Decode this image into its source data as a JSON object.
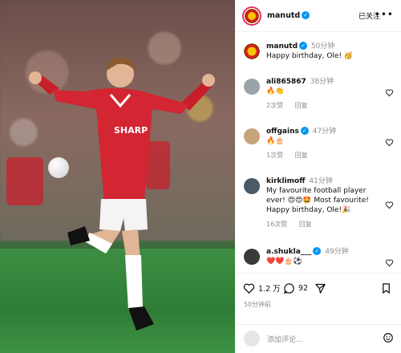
{
  "post": {
    "username": "manutd",
    "follow_label": "已关注",
    "more_label": "•••",
    "caption_user": "manutd",
    "caption_time": "50分钟",
    "caption_text": "Happy birthday, Ole! 🥳",
    "shirt_text": "SHARP"
  },
  "comments": [
    {
      "user": "ali865867",
      "verified": false,
      "time": "38分钟",
      "text": "🔥👏",
      "likes": "2次赞",
      "reply": "回复"
    },
    {
      "user": "offgains",
      "verified": true,
      "time": "47分钟",
      "text": "🔥🎂",
      "likes": "1次赞",
      "reply": "回复"
    },
    {
      "user": "kirklimoff",
      "verified": false,
      "time": "41分钟",
      "text": "My favourite football player ever! 😍😍🤩 Most favourite! Happy birthday, Ole!🎉",
      "likes": "16次赞",
      "reply": "回复"
    },
    {
      "user": "a.shukla___",
      "verified": true,
      "time": "49分钟",
      "text": "❤️❤️🎂⚽",
      "likes": "",
      "reply": ""
    }
  ],
  "actions": {
    "likes": "1.2 万",
    "comments": "92",
    "time_ago": "50分钟前"
  },
  "add_comment": {
    "placeholder": "添加评论..."
  },
  "colors": {
    "verified": "#0095f6",
    "story_ring": "#e1306c",
    "united_red": "#d81f26"
  },
  "icons": [
    "more-icon",
    "verified-icon",
    "heart-icon",
    "comment-icon",
    "share-icon",
    "bookmark-icon",
    "emoji-icon"
  ]
}
